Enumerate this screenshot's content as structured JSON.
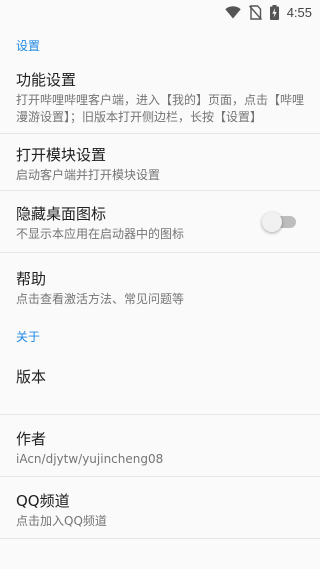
{
  "status_bar": {
    "time": "4:55"
  },
  "sections": [
    {
      "header": "设置"
    },
    {
      "header": "关于"
    }
  ],
  "settings": {
    "function_settings": {
      "title": "功能设置",
      "summary": "打开哔哩哔哩客户端，进入【我的】页面，点击【哔哩漫游设置】；旧版本打开侧边栏，长按【设置】"
    },
    "module_settings": {
      "title": "打开模块设置",
      "summary": "启动客户端并打开模块设置"
    },
    "hide_icon": {
      "title": "隐藏桌面图标",
      "summary": "不显示本应用在启动器中的图标",
      "enabled": false
    },
    "help": {
      "title": "帮助",
      "summary": "点击查看激活方法、常见问题等"
    }
  },
  "about": {
    "version": {
      "title": "版本",
      "summary": ""
    },
    "author": {
      "title": "作者",
      "summary": "iAcn/djytw/yujincheng08"
    },
    "qq_channel": {
      "title": "QQ频道",
      "summary": "点击加入QQ频道"
    }
  },
  "colors": {
    "accent": "#1e88e5",
    "background": "#fafafa"
  }
}
